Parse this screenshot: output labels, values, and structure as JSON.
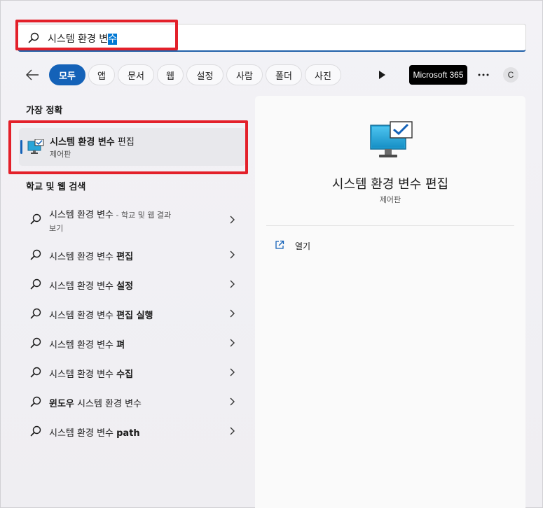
{
  "search": {
    "query_main": "시스템 환경 변",
    "query_selected": "수"
  },
  "filters": {
    "chips": [
      {
        "label": "모두",
        "active": true
      },
      {
        "label": "앱",
        "active": false
      },
      {
        "label": "문서",
        "active": false
      },
      {
        "label": "웹",
        "active": false
      },
      {
        "label": "설정",
        "active": false
      },
      {
        "label": "사람",
        "active": false
      },
      {
        "label": "폴더",
        "active": false
      },
      {
        "label": "사진",
        "active": false
      }
    ],
    "m365_label": "Microsoft 365",
    "avatar_initial": "C"
  },
  "best_match": {
    "section_title": "가장 정확",
    "title_bold": "시스템 환경 변수",
    "title_rest": " 편집",
    "subtitle": "제어판"
  },
  "web_search": {
    "section_title": "학교 및 웹 검색",
    "items": [
      {
        "normal": "시스템 환경 변수",
        "bold": "",
        "suffix": " - 학교 및 웹 결과",
        "line2": "보기"
      },
      {
        "normal": "시스템 환경 변수 ",
        "bold": "편집",
        "suffix": "",
        "line2": ""
      },
      {
        "normal": "시스템 환경 변수 ",
        "bold": "설정",
        "suffix": "",
        "line2": ""
      },
      {
        "normal": "시스템 환경 변수 ",
        "bold": "편집 실행",
        "suffix": "",
        "line2": ""
      },
      {
        "normal": "시스템 환경 변수 ",
        "bold": "펴",
        "suffix": "",
        "line2": ""
      },
      {
        "normal": "시스템 환경 변수 ",
        "bold": "수집",
        "suffix": "",
        "line2": ""
      },
      {
        "normal": "",
        "bold": "윈도우",
        "normal_after": " 시스템 환경 변수",
        "suffix": "",
        "line2": ""
      },
      {
        "normal": "시스템 환경 변수 ",
        "bold": "path",
        "suffix": "",
        "line2": ""
      }
    ]
  },
  "detail": {
    "title": "시스템 환경 변수 편집",
    "subtitle": "제어판",
    "action_label": "열기"
  },
  "colors": {
    "accent": "#1462b8",
    "highlight": "#e3202a"
  }
}
